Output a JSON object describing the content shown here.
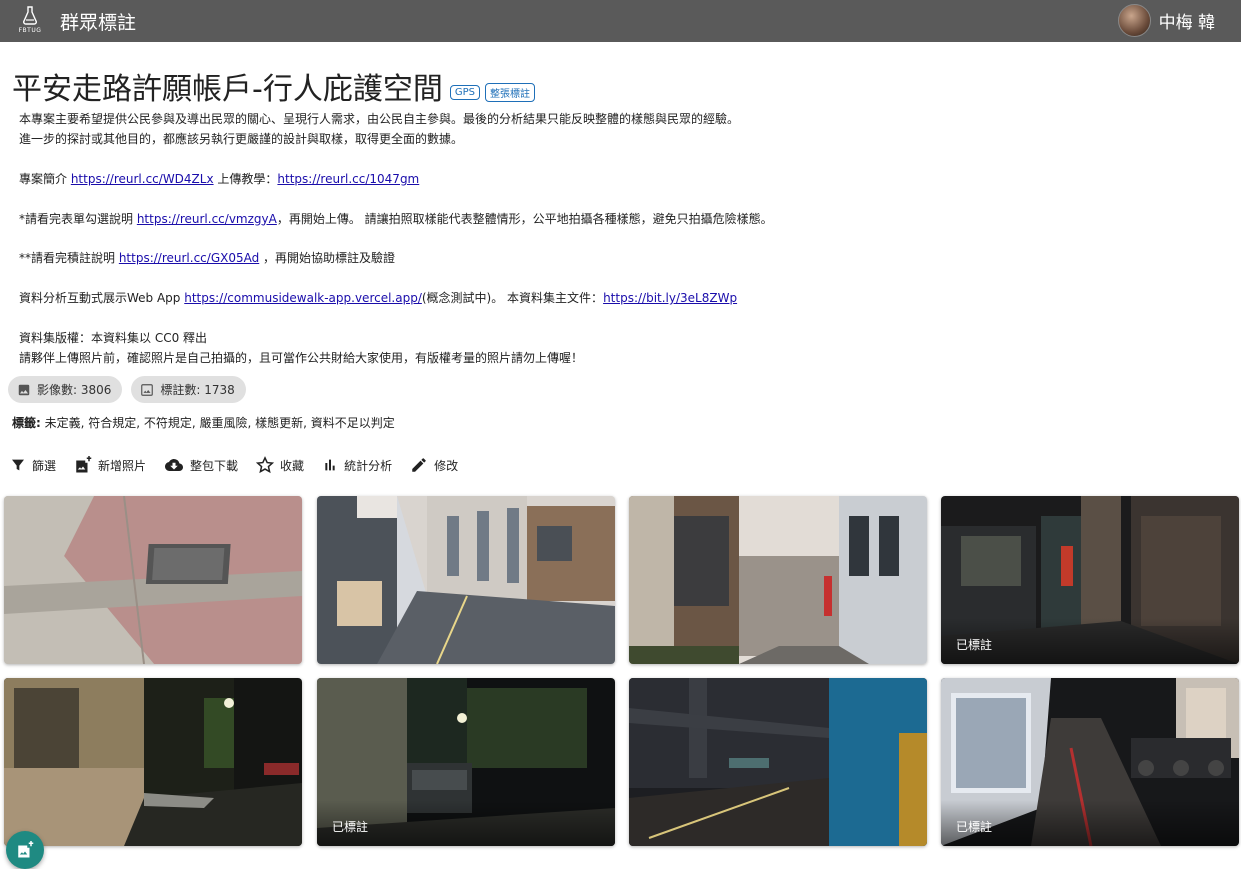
{
  "header": {
    "logo_text": "FBTUG",
    "app_title": "群眾標註",
    "user_name": "中梅 韓"
  },
  "project": {
    "title": "平安走路許願帳戶-行人庇護空間",
    "tags": [
      "GPS",
      "整張標註"
    ],
    "description": {
      "line1": "本專案主要希望提供公民參與及導出民眾的關心、呈現行人需求，由公民自主參與。最後的分析結果只能反映整體的樣態與民眾的經驗。",
      "line2": "進一步的探討或其他目的，都應該另執行更嚴謹的設計與取樣，取得更全面的數據。",
      "intro_prefix": "專案簡介 ",
      "intro_link": "https://reurl.cc/WD4ZLx",
      "tutorial_prefix": " 上傳教學：",
      "tutorial_link": "https://reurl.cc/1047gm",
      "form_prefix": "*請看完表單勾選說明 ",
      "form_link": "https://reurl.cc/vmzgyA",
      "form_suffix": "，再開始上傳。 請讓拍照取樣能代表整體情形，公平地拍攝各種樣態，避免只拍攝危險樣態。",
      "annot_prefix": "**請看完積註說明 ",
      "annot_link": "https://reurl.cc/GX05Ad",
      "annot_suffix": " ，再開始協助標註及驗證",
      "app_prefix": "資料分析互動式展示Web App ",
      "app_link": "https://commusidewalk-app.vercel.app/",
      "app_suffix": "(概念測試中)。 本資料集主文件：",
      "doc_link": "https://bit.ly/3eL8ZWp",
      "license_line": "資料集版權：本資料集以 CC0 釋出",
      "warning_line": "請夥伴上傳照片前，確認照片是自己拍攝的，且可當作公共財給大家使用，有版權考量的照片請勿上傳喔！"
    },
    "stats": {
      "images": "影像數: 3806",
      "annotations": "標註數: 1738"
    },
    "tags_label": "標籤:",
    "tags_values": " 未定義, 符合規定, 不符規定, 嚴重風險, 樣態更新, 資料不足以判定"
  },
  "toolbar": {
    "filter": "篩選",
    "add_photo": "新增照片",
    "download": "整包下載",
    "favorite": "收藏",
    "stats": "統計分析",
    "edit": "修改"
  },
  "photos": [
    {
      "label": ""
    },
    {
      "label": ""
    },
    {
      "label": ""
    },
    {
      "label": "已標註"
    },
    {
      "label": ""
    },
    {
      "label": "已標註"
    },
    {
      "label": ""
    },
    {
      "label": "已標註"
    }
  ]
}
